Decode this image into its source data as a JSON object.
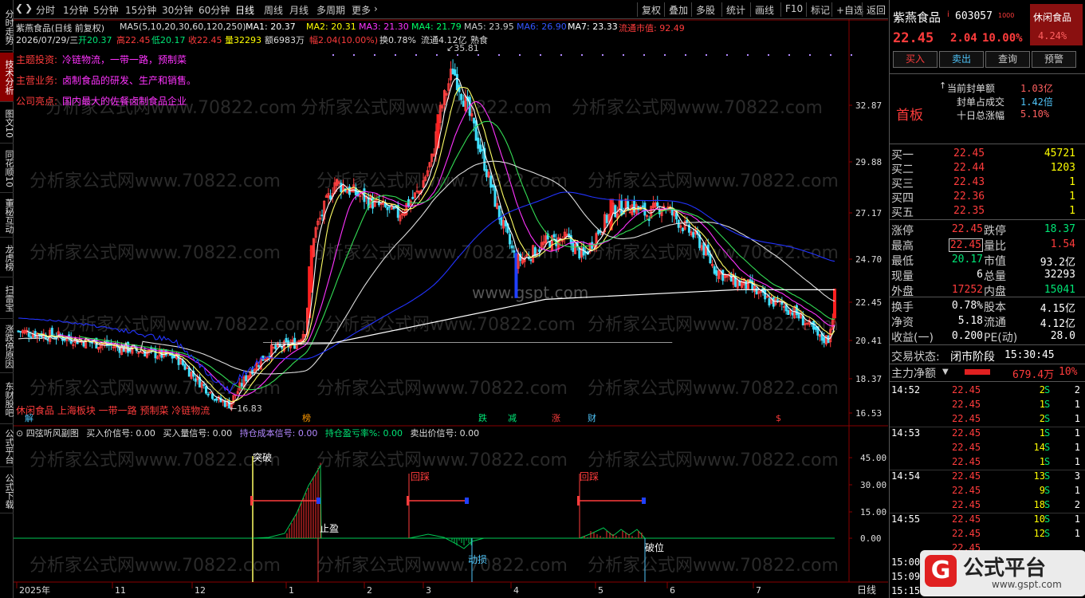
{
  "toolbar": {
    "items": [
      "分时",
      "1分钟",
      "5分钟",
      "15分钟",
      "30分钟",
      "60分钟",
      "日线",
      "周线",
      "月线",
      "多周期",
      "更多"
    ],
    "selected": "日线",
    "right_items": [
      "复权",
      "叠加",
      "多股",
      "统计",
      "画线",
      "F10",
      "标记",
      "+自选",
      "返回"
    ]
  },
  "left_tabs": [
    "分时走势",
    "技术分析",
    "图文10",
    "同花顺10",
    "董秘互动",
    "龙虎榜",
    "扫雷宝",
    "涨跌停原因",
    "东财股吧",
    "公式平台",
    "公式下载"
  ],
  "chart_header": {
    "stock": "紫燕食品(日线 前复权)",
    "ma_label": "MA5(5,10,20,30,60,120,250)",
    "ma1": "MA1: 20.37",
    "ma2": "MA2: 20.31",
    "ma3": "MA3: 21.30",
    "ma4": "MA4: 21.79",
    "ma5": "MA5: 23.95",
    "ma6": "MA6: 26.90",
    "ma7": "MA7: 23.33",
    "market_value": "流通市值: 92.49",
    "date": "2026/07/29/三",
    "open": "开20.37",
    "high": "高22.45",
    "low": "低20.17",
    "close": "收22.45",
    "vol": "量32293",
    "amount": "额6983万",
    "pct": "幅2.04(10.00%)",
    "turnover": "换0.78%",
    "float": "流通4.12亿",
    "sector": "熟食"
  },
  "notes": [
    {
      "label": "主题投资:",
      "text": "冷链物流，一带一路，预制菜"
    },
    {
      "label": "主营业务:",
      "text": "卤制食品的研发、生产和销售。"
    },
    {
      "label": "公司亮点:",
      "text": "国内最大的佐餐卤制食品企业"
    }
  ],
  "bottom_note": "休闲食品 上海板块 一带一路 预制菜 冷链物流",
  "price_axis": [
    "32.87",
    "29.88",
    "27.17",
    "24.70",
    "22.45",
    "20.41",
    "18.37",
    "16.53"
  ],
  "peak_label": "35.81",
  "low_label": "16.83",
  "markers": [
    "解",
    "榜",
    "跌",
    "减",
    "涨",
    "财",
    "$"
  ],
  "watermark": "分析家公式网www.70822.com",
  "watermark2": "www.gspt.com",
  "sub_header": {
    "name": "四弦听风副图",
    "s1": "买入价信号: 0.00",
    "s2": "买入量信号: 0.00",
    "s3": "持仓成本信号: 0.00",
    "s4": "持仓盈亏率%: 0.00",
    "s5": "卖出价信号: 0.00"
  },
  "sub_axis": [
    "45.00",
    "30.00",
    "15.00",
    "0.00"
  ],
  "sub_labels": [
    "突破",
    "止盈",
    "回踩",
    "动损",
    "回踩",
    "破位"
  ],
  "date_axis": [
    "2025年",
    "11",
    "12",
    "1",
    "2",
    "3",
    "4",
    "5",
    "6",
    "7"
  ],
  "period_label": "日线",
  "right_panel": {
    "name": "紫燕食品",
    "code": "603057",
    "tag": "休闲食品",
    "tag_pct": "4.24%",
    "price": "22.45",
    "change": "2.04",
    "change_pct": "10.00%",
    "buttons": [
      "买入",
      "卖出",
      "查询",
      "预警"
    ],
    "seal": [
      {
        "label": "当前封单额",
        "value": "1.03亿"
      },
      {
        "label": "封单占成交",
        "value": "1.42倍"
      },
      {
        "label": "十日总涨幅",
        "value": "5.10%"
      }
    ],
    "first_board": "首板",
    "bids": [
      {
        "label": "买一",
        "price": "22.45",
        "vol": "45721"
      },
      {
        "label": "买二",
        "price": "22.44",
        "vol": "1203"
      },
      {
        "label": "买三",
        "price": "22.43",
        "vol": "1"
      },
      {
        "label": "买四",
        "price": "22.36",
        "vol": "1"
      },
      {
        "label": "买五",
        "price": "22.35",
        "vol": "1"
      }
    ],
    "stats": [
      {
        "l1": "涨停",
        "v1": "22.45",
        "l2": "跌停",
        "v2": "18.37"
      },
      {
        "l1": "最高",
        "v1": "22.45",
        "l2": "量比",
        "v2": "1.54"
      },
      {
        "l1": "最低",
        "v1": "20.17",
        "l2": "市值",
        "v2": "93.2亿"
      },
      {
        "l1": "现量",
        "v1": "6",
        "l2": "总量",
        "v2": "32293"
      },
      {
        "l1": "外盘",
        "v1": "17252",
        "l2": "内盘",
        "v2": "15041"
      }
    ],
    "stats2": [
      {
        "l1": "换手",
        "v1": "0.78%",
        "l2": "股本",
        "v2": "4.15亿"
      },
      {
        "l1": "净资",
        "v1": "5.18",
        "l2": "流通",
        "v2": "4.12亿"
      },
      {
        "l1": "收益(一)",
        "v1": "0.200",
        "l2": "PE(动)",
        "v2": "28.0"
      }
    ],
    "status_label": "交易状态:",
    "status_value": "闭市阶段",
    "status_time": "15:30:45",
    "net_label": "主力净额",
    "net_value": "679.4万",
    "net_pct": "10%",
    "ticks": [
      {
        "time": "14:52",
        "price": "22.45",
        "vol": "2",
        "side": "S",
        "n": "2"
      },
      {
        "time": "",
        "price": "22.45",
        "vol": "1",
        "side": "S",
        "n": "1"
      },
      {
        "time": "",
        "price": "22.45",
        "vol": "2",
        "side": "S",
        "n": "1"
      },
      {
        "time": "14:53",
        "price": "22.45",
        "vol": "1",
        "side": "S",
        "n": "1"
      },
      {
        "time": "",
        "price": "22.45",
        "vol": "14",
        "side": "S",
        "n": "1"
      },
      {
        "time": "",
        "price": "22.45",
        "vol": "1",
        "side": "S",
        "n": "1"
      },
      {
        "time": "14:54",
        "price": "22.45",
        "vol": "13",
        "side": "S",
        "n": "3"
      },
      {
        "time": "",
        "price": "22.45",
        "vol": "9",
        "side": "S",
        "n": "1"
      },
      {
        "time": "",
        "price": "22.45",
        "vol": "18",
        "side": "S",
        "n": "2"
      },
      {
        "time": "14:55",
        "price": "22.45",
        "vol": "10",
        "side": "S",
        "n": "1"
      },
      {
        "time": "",
        "price": "22.45",
        "vol": "12",
        "side": "S",
        "n": "1"
      },
      {
        "time": "",
        "price": "22.45",
        "vol": "",
        "side": "",
        "n": ""
      },
      {
        "time": "15:00",
        "price": "",
        "vol": "",
        "side": "",
        "n": ""
      },
      {
        "time": "15:09",
        "price": "",
        "vol": "",
        "side": "",
        "n": ""
      },
      {
        "time": "15:15",
        "price": "",
        "vol": "",
        "side": "",
        "n": ""
      }
    ],
    "logo_text": "公式平台",
    "logo_url": "www.gspt.com"
  }
}
